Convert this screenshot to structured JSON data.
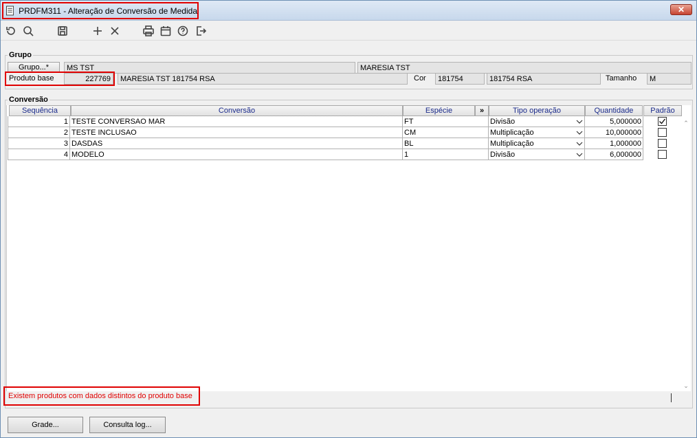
{
  "window": {
    "title": "PRDFM311 - Alteração de Conversão de Medida",
    "close_label": "✕"
  },
  "toolbar": {
    "icons": [
      "refresh-icon",
      "search-icon",
      "save-icon",
      "add-icon",
      "delete-icon",
      "print-icon",
      "calendar-icon",
      "help-icon",
      "exit-icon"
    ]
  },
  "grupo": {
    "section_label": "Grupo",
    "grupo_button": "Grupo...*",
    "grupo_code": "MS TST",
    "grupo_name": "MARESIA TST",
    "produto_label": "Produto base",
    "produto_code": "227769",
    "produto_name": "MARESIA TST 181754 RSA",
    "cor_label": "Cor",
    "cor_code": "181754",
    "cor_name": "181754 RSA",
    "tamanho_label": "Tamanho",
    "tamanho_value": "M"
  },
  "conversao": {
    "section_label": "Conversão",
    "columns": {
      "sequencia": "Sequência",
      "conversao": "Conversão",
      "especie": "Espécie",
      "more": "»",
      "tipo": "Tipo operação",
      "quantidade": "Quantidade",
      "padrao": "Padrão"
    },
    "rows": [
      {
        "seq": "1",
        "conversao": "TESTE CONVERSAO MAR",
        "especie": "FT",
        "tipo": "Divisão",
        "quantidade": "5,000000",
        "padrao": true
      },
      {
        "seq": "2",
        "conversao": "TESTE INCLUSAO",
        "especie": "CM",
        "tipo": "Multiplicação",
        "quantidade": "10,000000",
        "padrao": false
      },
      {
        "seq": "3",
        "conversao": "DASDAS",
        "especie": "BL",
        "tipo": "Multiplicação",
        "quantidade": "1,000000",
        "padrao": false
      },
      {
        "seq": "4",
        "conversao": "MODELO",
        "especie": "1",
        "tipo": "Divisão",
        "quantidade": "6,000000",
        "padrao": false
      }
    ]
  },
  "status": {
    "message": "Existem produtos com dados distintos do produto base"
  },
  "buttons": {
    "grade": "Grade...",
    "consulta_log": "Consulta log..."
  },
  "colors": {
    "highlight": "#e00000",
    "header_text": "#1a2a8a"
  }
}
